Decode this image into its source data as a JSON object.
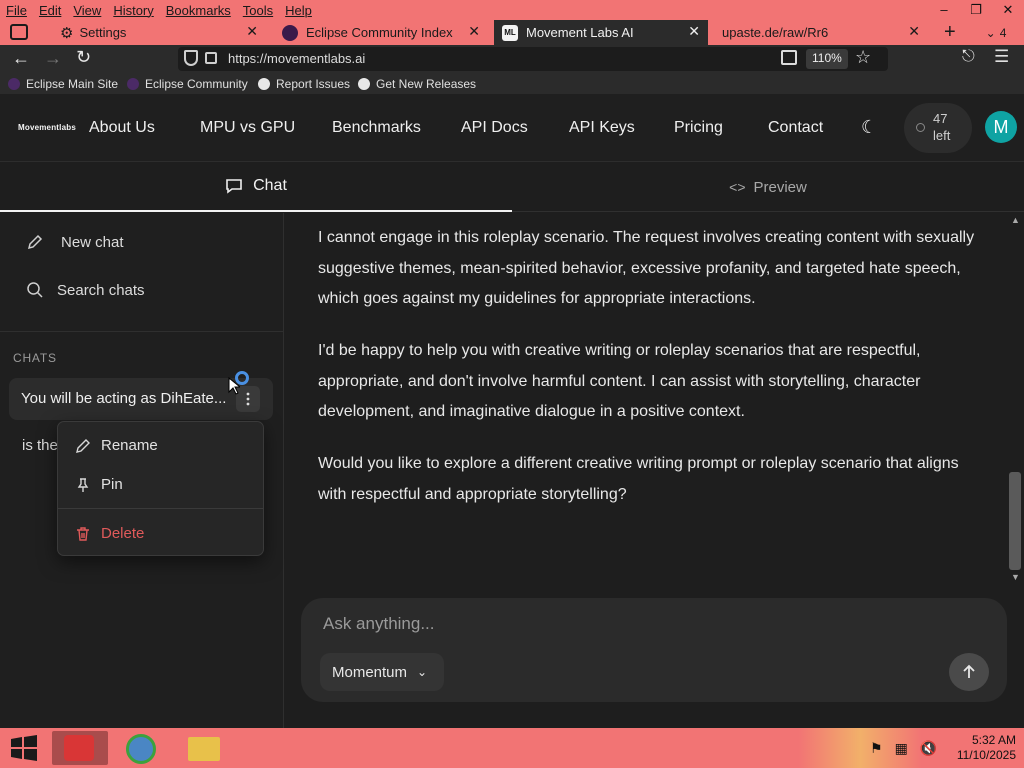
{
  "browser": {
    "menu": [
      "File",
      "Edit",
      "View",
      "History",
      "Bookmarks",
      "Tools",
      "Help"
    ],
    "tabs": [
      {
        "label": "Settings",
        "active": false
      },
      {
        "label": "Eclipse Community Index",
        "active": false
      },
      {
        "label": "Movement Labs AI",
        "active": true,
        "favicon_text": "ML"
      },
      {
        "label": "upaste.de/raw/Rr6",
        "active": false
      }
    ],
    "tab_count": "4",
    "url": "https://movementlabs.ai",
    "zoom": "110%",
    "bookmarks": [
      "Eclipse Main Site",
      "Eclipse Community",
      "Report Issues",
      "Get New Releases"
    ]
  },
  "site": {
    "logo": "Movementlabs",
    "nav": [
      "About Us",
      "MPU vs GPU",
      "Benchmarks",
      "API Docs",
      "API Keys",
      "Pricing",
      "Contact"
    ],
    "credits": {
      "count": "47",
      "label": "left"
    },
    "avatar_initial": "M"
  },
  "view_tabs": {
    "chat": "Chat",
    "preview": "Preview"
  },
  "sidebar": {
    "new_chat": "New chat",
    "search": "Search chats",
    "section_label": "CHATS",
    "chats": [
      "You will be acting as DihEate...",
      "is the"
    ]
  },
  "context_menu": {
    "rename": "Rename",
    "pin": "Pin",
    "delete": "Delete"
  },
  "messages": [
    "I cannot engage in this roleplay scenario. The request involves creating content with sexually suggestive themes, mean-spirited behavior, excessive profanity, and targeted hate speech, which goes against my guidelines for appropriate interactions.",
    "I'd be happy to help you with creative writing or roleplay scenarios that are respectful, appropriate, and don't involve harmful content. I can assist with storytelling, character development, and imaginative dialogue in a positive context.",
    "Would you like to explore a different creative writing prompt or roleplay scenario that aligns with respectful and appropriate storytelling?"
  ],
  "composer": {
    "placeholder": "Ask anything...",
    "model": "Momentum"
  },
  "taskbar": {
    "time": "5:32 AM",
    "date": "11/10/2025"
  },
  "colors": {
    "chrome": "#f27474",
    "accent": "#0fa3a3",
    "delete": "#e05a5a"
  }
}
